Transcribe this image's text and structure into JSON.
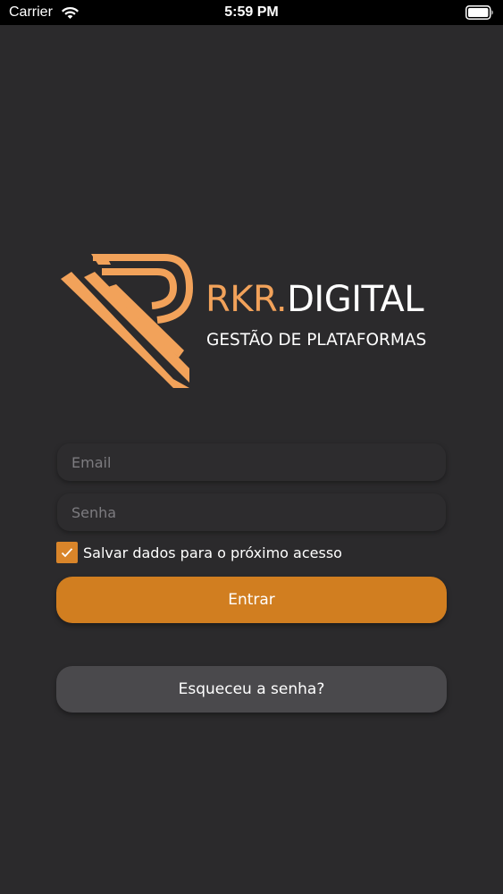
{
  "status_bar": {
    "carrier": "Carrier",
    "time": "5:59 PM",
    "wifi_icon": "wifi-icon",
    "battery_icon": "battery-icon"
  },
  "logo": {
    "brand_prefix": "RKR.",
    "brand_suffix": "DIGITAL",
    "tagline": "GESTÃO DE PLATAFORMAS",
    "accent_color": "#f2a25a"
  },
  "form": {
    "email_placeholder": "Email",
    "email_value": "",
    "password_placeholder": "Senha",
    "password_value": "",
    "remember_label": "Salvar dados para o próximo acesso",
    "remember_checked": true,
    "login_label": "Entrar",
    "forgot_label": "Esqueceu a senha?"
  },
  "colors": {
    "background": "#2b2a2c",
    "primary_button": "#d17e20",
    "secondary_button": "#4a494c",
    "checkbox": "#d9852a"
  }
}
